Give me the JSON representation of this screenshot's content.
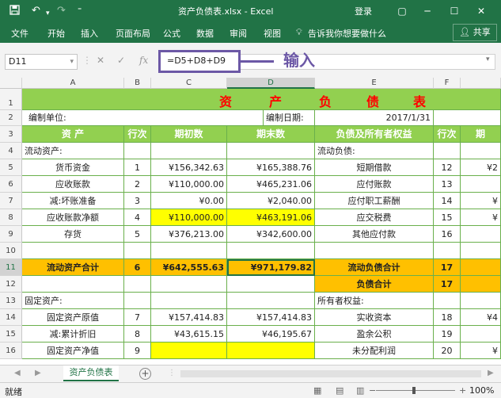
{
  "window": {
    "title": "资产负债表.xlsx - Excel",
    "login": "登录",
    "quick_access": {
      "save_icon": "save-icon",
      "undo_icon": "undo-icon",
      "redo_icon": "redo-icon",
      "customize_icon": "customize-icon"
    },
    "controls": {
      "restore": "▢",
      "minimize": "─",
      "maximize": "☐",
      "close": "✕"
    }
  },
  "ribbon": {
    "tabs": [
      "文件",
      "开始",
      "插入",
      "页面布局",
      "公式",
      "数据",
      "审阅",
      "视图"
    ],
    "tell_me": "告诉我你想要做什么",
    "share": "共享"
  },
  "formula_bar": {
    "name_box": "D11",
    "fx_label": "fx",
    "formula": "=D5+D8+D9",
    "callout": "输入"
  },
  "columns": [
    "A",
    "B",
    "C",
    "D",
    "E",
    "F"
  ],
  "rows": [
    "1",
    "2",
    "3",
    "4",
    "5",
    "6",
    "7",
    "8",
    "9",
    "10",
    "11",
    "12",
    "13",
    "14",
    "15",
    "16"
  ],
  "sheet": {
    "title": [
      "资",
      "产",
      "负",
      "债",
      "表"
    ],
    "row2": {
      "unit_label": "编制单位:",
      "date_label": "编制日期:",
      "date_value": "2017/1/31"
    },
    "header": {
      "asset": "资          产",
      "line": "行次",
      "begin": "期初数",
      "end": "期末数",
      "liab": "负债及所有者权益",
      "line2": "行次",
      "cut": "期"
    },
    "r4": {
      "a": "流动资产:",
      "e": "流动负债:"
    },
    "r5": {
      "a": "货币资金",
      "b": "1",
      "c": "¥156,342.63",
      "d": "¥165,388.76",
      "e": "短期借款",
      "f": "12",
      "g": "¥2"
    },
    "r6": {
      "a": "应收账款",
      "b": "2",
      "c": "¥110,000.00",
      "d": "¥465,231.06",
      "e": "应付账款",
      "f": "13",
      "g": ""
    },
    "r7": {
      "a": "减:坏账准备",
      "b": "3",
      "c": "¥0.00",
      "d": "¥2,040.00",
      "e": "应付职工薪酬",
      "f": "14",
      "g": "¥"
    },
    "r8": {
      "a": "应收账款净额",
      "b": "4",
      "c": "¥110,000.00",
      "d": "¥463,191.06",
      "e": "应交税费",
      "f": "15",
      "g": "¥"
    },
    "r9": {
      "a": "存货",
      "b": "5",
      "c": "¥376,213.00",
      "d": "¥342,600.00",
      "e": "其他应付款",
      "f": "16",
      "g": ""
    },
    "r11": {
      "a": "流动资产合计",
      "b": "6",
      "c": "¥642,555.63",
      "d": "¥971,179.82",
      "e": "流动负债合计",
      "f": "17"
    },
    "r12": {
      "e": "负债合计",
      "f": "17"
    },
    "r13": {
      "a": "固定资产:",
      "e": "所有者权益:"
    },
    "r14": {
      "a": "固定资产原值",
      "b": "7",
      "c": "¥157,414.83",
      "d": "¥157,414.83",
      "e": "实收资本",
      "f": "18",
      "g": "¥4"
    },
    "r15": {
      "a": "减:累计折旧",
      "b": "8",
      "c": "¥43,615.15",
      "d": "¥46,195.67",
      "e": "盈余公积",
      "f": "19",
      "g": ""
    },
    "r16": {
      "a": "固定资产净值",
      "b": "9",
      "e": "未分配利润",
      "f": "20",
      "g": "¥"
    }
  },
  "sheet_tabs": {
    "active": "资产负债表",
    "prev": "◀",
    "next": "▶",
    "add": "+"
  },
  "status": {
    "ready": "就绪",
    "zoom": "100%",
    "minus": "−",
    "plus": "+"
  },
  "colors": {
    "excel_green": "#217346",
    "header_green": "#92d050",
    "total_orange": "#ffc000",
    "highlight_yellow": "#ffff00",
    "title_red": "#ff0000",
    "callout_purple": "#6c58a6"
  }
}
